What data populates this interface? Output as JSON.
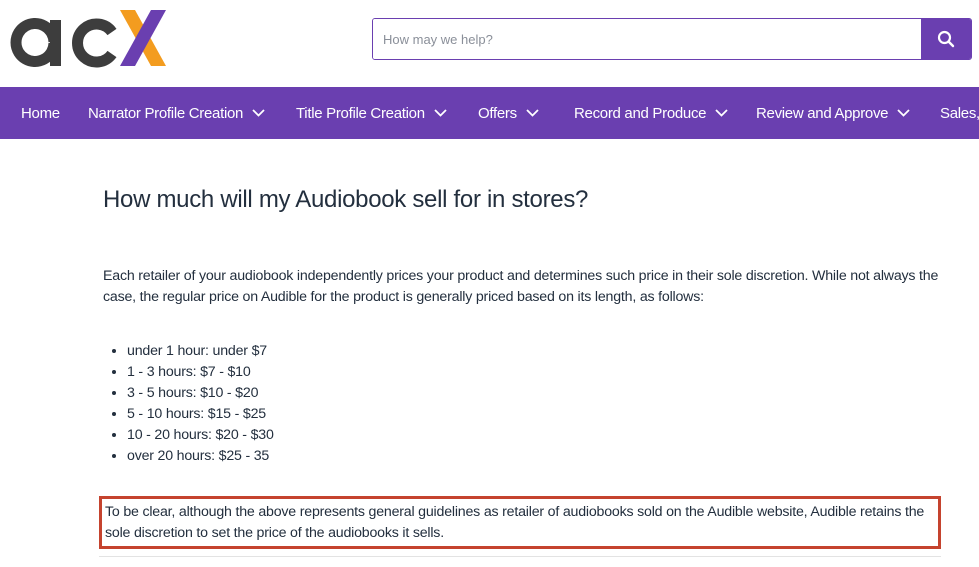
{
  "header": {
    "logo_text": "acx",
    "search": {
      "placeholder": "How may we help?",
      "value": ""
    },
    "search_icon": "search-icon"
  },
  "nav": {
    "items": [
      {
        "label": "Home",
        "dropdown": false
      },
      {
        "label": "Narrator Profile Creation",
        "dropdown": true
      },
      {
        "label": "Title Profile Creation",
        "dropdown": true
      },
      {
        "label": "Offers",
        "dropdown": true
      },
      {
        "label": "Record and Produce",
        "dropdown": true
      },
      {
        "label": "Review and Approve",
        "dropdown": true
      },
      {
        "label": "Sales,",
        "dropdown": false
      }
    ]
  },
  "article": {
    "title": "How much will my Audiobook sell for in stores?",
    "intro": "Each retailer of your audiobook independently prices your product and determines such price in their sole discretion. While not always the case, the regular price on Audible for the product is generally priced based on its length, as follows:",
    "price_list": [
      "under 1 hour: under $7",
      "1 - 3 hours: $7 - $10",
      "3 - 5 hours: $10 - $20",
      "5 - 10 hours: $15 - $25",
      "10 - 20 hours: $20 - $30",
      "over 20 hours: $25 - 35"
    ],
    "notice": "To be clear, although the above represents general guidelines as retailer of audiobooks sold on the Audible website, Audible retains the sole discretion to set the price of the audiobooks it sells."
  },
  "colors": {
    "brand_purple": "#6a3fb0",
    "logo_orange": "#f39c1f",
    "logo_dark": "#3d3d3d",
    "highlight_border": "#c5432e",
    "text": "#232f3e"
  }
}
